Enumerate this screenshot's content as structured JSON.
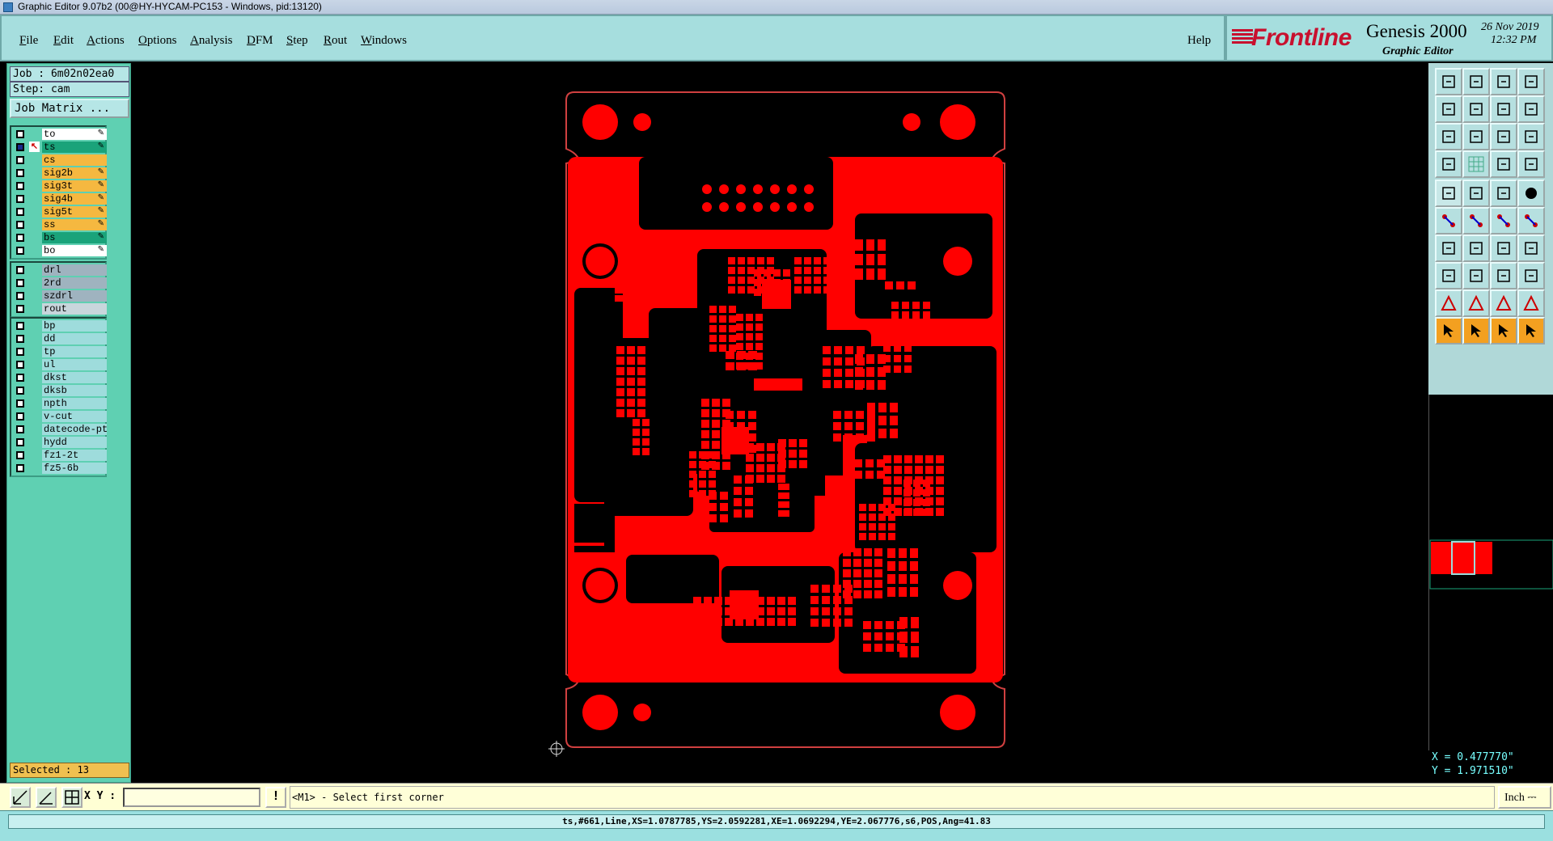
{
  "window": {
    "title": "Graphic Editor 9.07b2 (00@HY-HYCAM-PC153 - Windows, pid:13120)"
  },
  "menu": {
    "items": [
      {
        "label": "File",
        "u": "F",
        "rest": "ile"
      },
      {
        "label": "Edit",
        "u": "E",
        "rest": "dit"
      },
      {
        "label": "Actions",
        "u": "A",
        "rest": "ctions"
      },
      {
        "label": "Options",
        "u": "O",
        "rest": "ptions"
      },
      {
        "label": "Analysis",
        "u": "A",
        "rest": "nalysis"
      },
      {
        "label": "DFM",
        "u": "D",
        "rest": "FM"
      },
      {
        "label": "Step",
        "u": "S",
        "rest": "tep"
      },
      {
        "label": "Rout",
        "u": "R",
        "rest": "out"
      },
      {
        "label": "Windows",
        "u": "W",
        "rest": "indows"
      }
    ],
    "help": "Help"
  },
  "brand": {
    "logo": "Frontline",
    "product": "Genesis 2000",
    "subtitle": "Graphic Editor",
    "date": "26 Nov 2019",
    "time": "12:32 PM",
    "color": "#c8102e"
  },
  "job": {
    "job": "Job : 6m02n02ea0",
    "step": "Step: cam",
    "matrix_button": "Job Matrix ..."
  },
  "layers": {
    "board": [
      {
        "name": "to",
        "color": "#ffffff",
        "flag": "✎"
      },
      {
        "name": "ts",
        "color": "#1aa37a",
        "flag": "✎",
        "active": true
      },
      {
        "name": "cs",
        "color": "#f5b840",
        "flag": ""
      },
      {
        "name": "sig2b",
        "color": "#f5b840",
        "flag": "✎"
      },
      {
        "name": "sig3t",
        "color": "#f5b840",
        "flag": "✎"
      },
      {
        "name": "sig4b",
        "color": "#f5b840",
        "flag": "✎"
      },
      {
        "name": "sig5t",
        "color": "#f5b840",
        "flag": "✎"
      },
      {
        "name": "ss",
        "color": "#f5b840",
        "flag": "✎"
      },
      {
        "name": "bs",
        "color": "#1aa37a",
        "flag": "✎"
      },
      {
        "name": "bo",
        "color": "#ffffff",
        "flag": "✎"
      }
    ],
    "drill": [
      {
        "name": "drl",
        "color": "#9fb3bf"
      },
      {
        "name": "2rd",
        "color": "#9fb3bf"
      },
      {
        "name": "szdrl",
        "color": "#9fb3bf"
      },
      {
        "name": "rout",
        "color": "#c8d6dc"
      }
    ],
    "misc": [
      {
        "name": "bp",
        "color": "#9edcdc"
      },
      {
        "name": "dd",
        "color": "#9edcdc"
      },
      {
        "name": "tp",
        "color": "#9edcdc"
      },
      {
        "name": "ul",
        "color": "#9edcdc"
      },
      {
        "name": "dkst",
        "color": "#9edcdc"
      },
      {
        "name": "dksb",
        "color": "#9edcdc"
      },
      {
        "name": "npth",
        "color": "#9edcdc"
      },
      {
        "name": "v-cut",
        "color": "#9edcdc"
      },
      {
        "name": "datecode-pt",
        "color": "#9edcdc"
      },
      {
        "name": "hydd",
        "color": "#9edcdc"
      },
      {
        "name": "fz1-2t",
        "color": "#9edcdc"
      },
      {
        "name": "fz5-6b",
        "color": "#9edcdc"
      }
    ]
  },
  "selected": "Selected : 13",
  "coords": {
    "x": "X = 0.477770\"",
    "y": "Y = 1.971510\""
  },
  "command": {
    "xy_label": "X Y :",
    "xy_value": "",
    "excl": "!",
    "prompt": "<M1> - Select first corner",
    "units": "Inch ⎓"
  },
  "status": "ts,#661,Line,XS=1.0787785,YS=2.0592281,XE=1.0692294,YE=2.067776,s6,POS,Ang=41.83",
  "colors": {
    "copper": "#ff0000",
    "outline": "#d04040",
    "panel": "#5fd0b2",
    "menu": "#a6dede"
  }
}
